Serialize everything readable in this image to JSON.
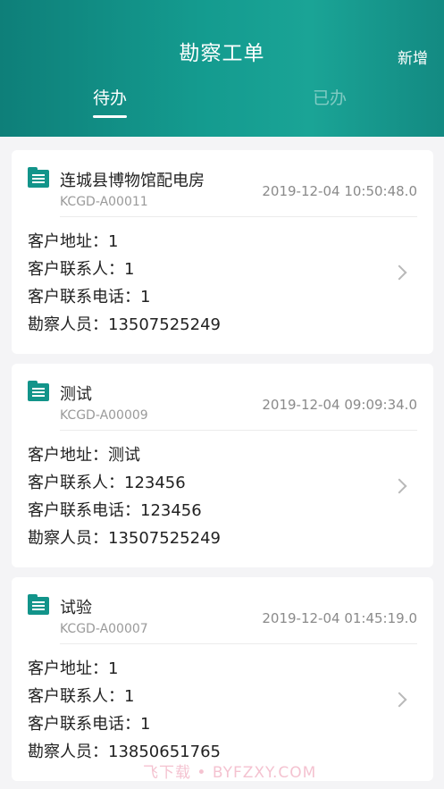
{
  "header": {
    "title": "勘察工单",
    "add_label": "新增",
    "tabs": [
      {
        "label": "待办",
        "active": true
      },
      {
        "label": "已办",
        "active": false
      }
    ]
  },
  "colors": {
    "header_start": "#0e7f79",
    "header_end": "#1aa496",
    "icon": "#12948a",
    "page_bg": "#f4f4f6"
  },
  "cards": [
    {
      "name": "连城县博物馆配电房",
      "code": "KCGD-A00011",
      "time": "2019-12-04 10:50:48.0",
      "lines": [
        "客户地址：1",
        "客户联系人：1",
        "客户联系电话：1",
        "勘察人员：13507525249"
      ],
      "icon": "document-icon",
      "chevron": "chevron-right-icon"
    },
    {
      "name": "测试",
      "code": "KCGD-A00009",
      "time": "2019-12-04 09:09:34.0",
      "lines": [
        "客户地址：测试",
        "客户联系人：123456",
        "客户联系电话：123456",
        "勘察人员：13507525249"
      ],
      "icon": "document-icon",
      "chevron": "chevron-right-icon"
    },
    {
      "name": "试验",
      "code": "KCGD-A00007",
      "time": "2019-12-04 01:45:19.0",
      "lines": [
        "客户地址：1",
        "客户联系人：1",
        "客户联系电话：1",
        "勘察人员：13850651765"
      ],
      "icon": "document-icon",
      "chevron": "chevron-right-icon"
    }
  ],
  "watermark": "飞下载 • BYFZXY.COM"
}
